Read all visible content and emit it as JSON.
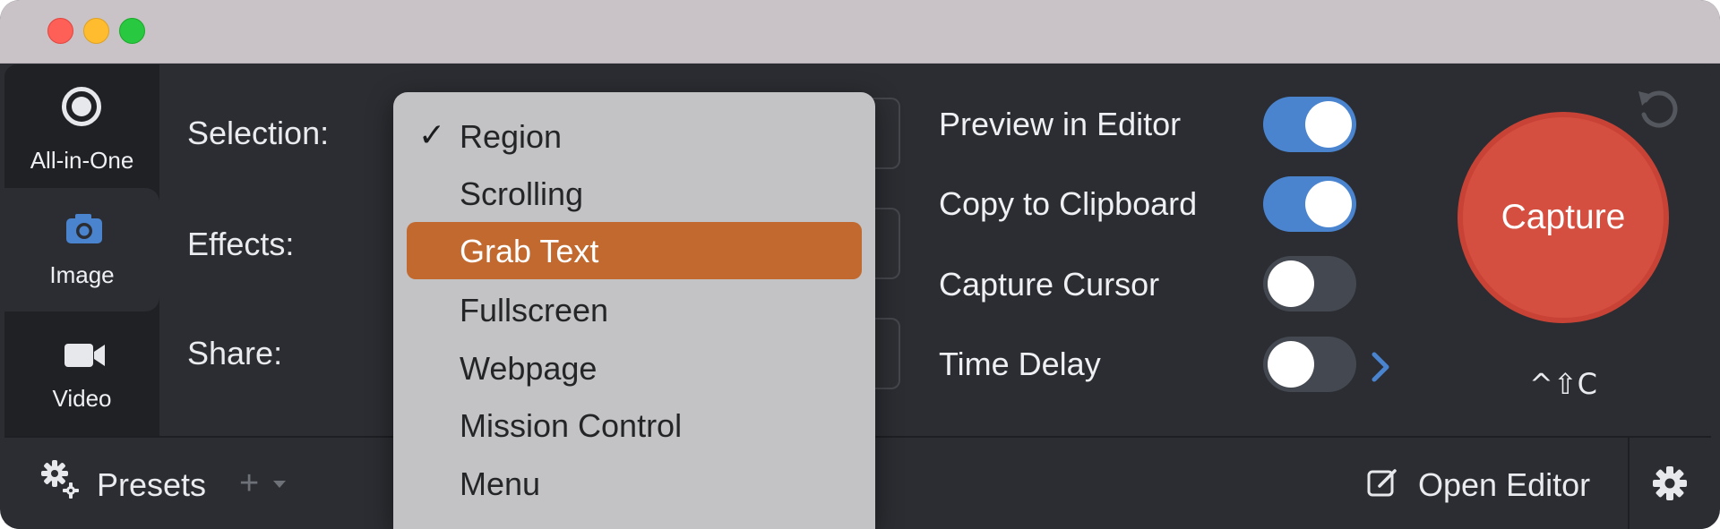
{
  "modes": [
    {
      "label": "All-in-One",
      "icon": "record-circle-icon"
    },
    {
      "label": "Image",
      "icon": "camera-icon"
    },
    {
      "label": "Video",
      "icon": "video-camera-icon"
    }
  ],
  "settings": {
    "selection_label": "Selection:",
    "effects_label": "Effects:",
    "share_label": "Share:"
  },
  "options": [
    {
      "label": "Preview in Editor",
      "on": true
    },
    {
      "label": "Copy to Clipboard",
      "on": true
    },
    {
      "label": "Capture Cursor",
      "on": false
    },
    {
      "label": "Time Delay",
      "on": false
    }
  ],
  "capture": {
    "label": "Capture",
    "shortcut": "^⇧C"
  },
  "bottom": {
    "presets_label": "Presets",
    "add_symbol": "+",
    "open_editor_label": "Open Editor"
  },
  "selection_menu": {
    "selected": "Region",
    "highlighted": "Grab Text",
    "check_mark": "✓",
    "items": [
      "Region",
      "Scrolling",
      "Grab Text",
      "Fullscreen",
      "Webpage",
      "Mission Control",
      "Menu"
    ]
  },
  "colors": {
    "capture": "#d44f40",
    "toggle_on": "#4a84cf",
    "menu_highlight": "#c1692f",
    "chevron": "#4a84cf"
  }
}
